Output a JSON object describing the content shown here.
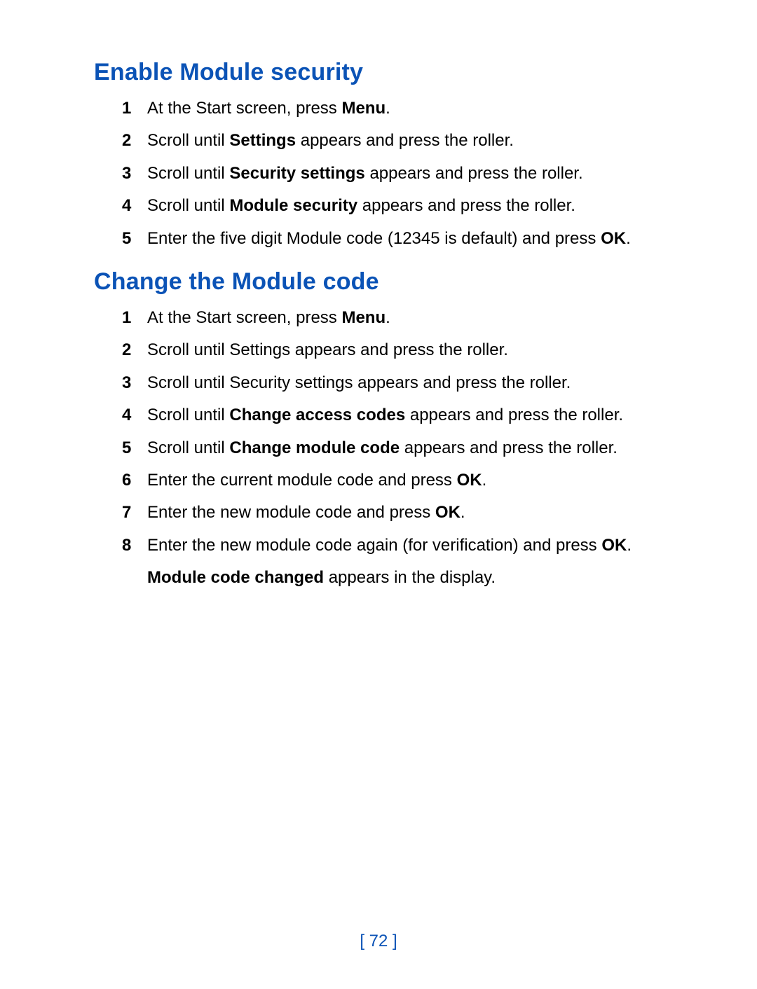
{
  "colors": {
    "heading": "#0b53b6"
  },
  "sections": [
    {
      "heading": "Enable Module security",
      "steps": [
        {
          "segments": [
            {
              "t": "At the Start screen, press "
            },
            {
              "t": "Menu",
              "b": true
            },
            {
              "t": "."
            }
          ]
        },
        {
          "segments": [
            {
              "t": "Scroll until "
            },
            {
              "t": "Settings",
              "b": true
            },
            {
              "t": " appears and press the roller."
            }
          ]
        },
        {
          "segments": [
            {
              "t": "Scroll until "
            },
            {
              "t": "Security settings",
              "b": true
            },
            {
              "t": " appears and press the roller."
            }
          ]
        },
        {
          "segments": [
            {
              "t": "Scroll until "
            },
            {
              "t": "Module security",
              "b": true
            },
            {
              "t": " appears and press the roller."
            }
          ]
        },
        {
          "segments": [
            {
              "t": "Enter the five digit Module code (12345 is default) and press "
            },
            {
              "t": "OK",
              "b": true
            },
            {
              "t": "."
            }
          ]
        }
      ]
    },
    {
      "heading": "Change the Module code",
      "steps": [
        {
          "segments": [
            {
              "t": "At the Start screen, press "
            },
            {
              "t": "Menu",
              "b": true
            },
            {
              "t": "."
            }
          ]
        },
        {
          "segments": [
            {
              "t": "Scroll until Settings appears and press the roller."
            }
          ]
        },
        {
          "segments": [
            {
              "t": "Scroll until Security settings appears and press the roller."
            }
          ]
        },
        {
          "segments": [
            {
              "t": "Scroll until "
            },
            {
              "t": "Change access codes",
              "b": true
            },
            {
              "t": " appears and press the roller."
            }
          ]
        },
        {
          "segments": [
            {
              "t": "Scroll until "
            },
            {
              "t": "Change module code",
              "b": true
            },
            {
              "t": " appears and press the roller."
            }
          ]
        },
        {
          "segments": [
            {
              "t": "Enter the current module code and press "
            },
            {
              "t": "OK",
              "b": true
            },
            {
              "t": "."
            }
          ]
        },
        {
          "segments": [
            {
              "t": "Enter the new module code and press "
            },
            {
              "t": "OK",
              "b": true
            },
            {
              "t": "."
            }
          ]
        },
        {
          "segments": [
            {
              "t": "Enter the new module code again (for verification) and press "
            },
            {
              "t": "OK",
              "b": true
            },
            {
              "t": "."
            }
          ],
          "extra": [
            {
              "t": "Module code changed",
              "b": true
            },
            {
              "t": " appears in the display."
            }
          ]
        }
      ]
    }
  ],
  "page_number": "[ 72 ]"
}
